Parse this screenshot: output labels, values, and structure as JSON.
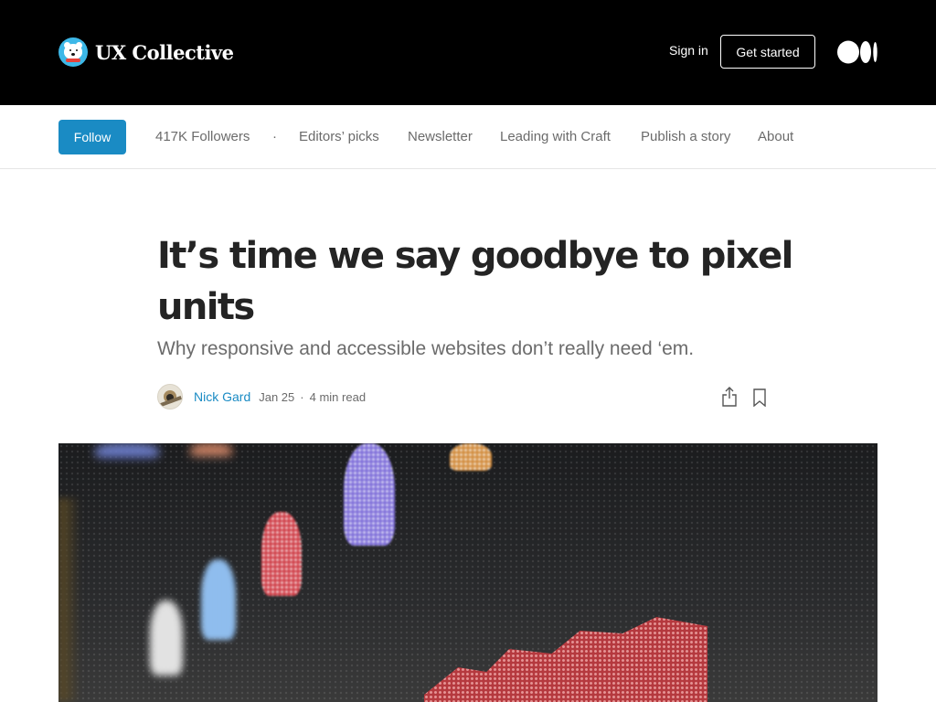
{
  "header": {
    "brand_name": "UX Collective",
    "sign_in": "Sign in",
    "get_started": "Get started"
  },
  "subnav": {
    "follow": "Follow",
    "followers": "417K Followers",
    "separator": "·",
    "items": [
      "Editors’ picks",
      "Newsletter",
      "Leading with Craft",
      "Publish a story",
      "About"
    ]
  },
  "article": {
    "title": "It’s time we say goodbye to pixel units",
    "subtitle": "Why responsive and accessible websites don’t really need ‘em.",
    "author": "Nick Gard",
    "date": "Jan 25",
    "dot": "·",
    "read_time": "4 min read"
  },
  "colors": {
    "header_bg": "#000000",
    "accent": "#1a8bc4",
    "brand_logo": "#3db8e8"
  },
  "icons": {
    "brand": "polar-bear-logo",
    "medium": "medium-logo",
    "share": "share-icon",
    "bookmark": "bookmark-icon"
  }
}
